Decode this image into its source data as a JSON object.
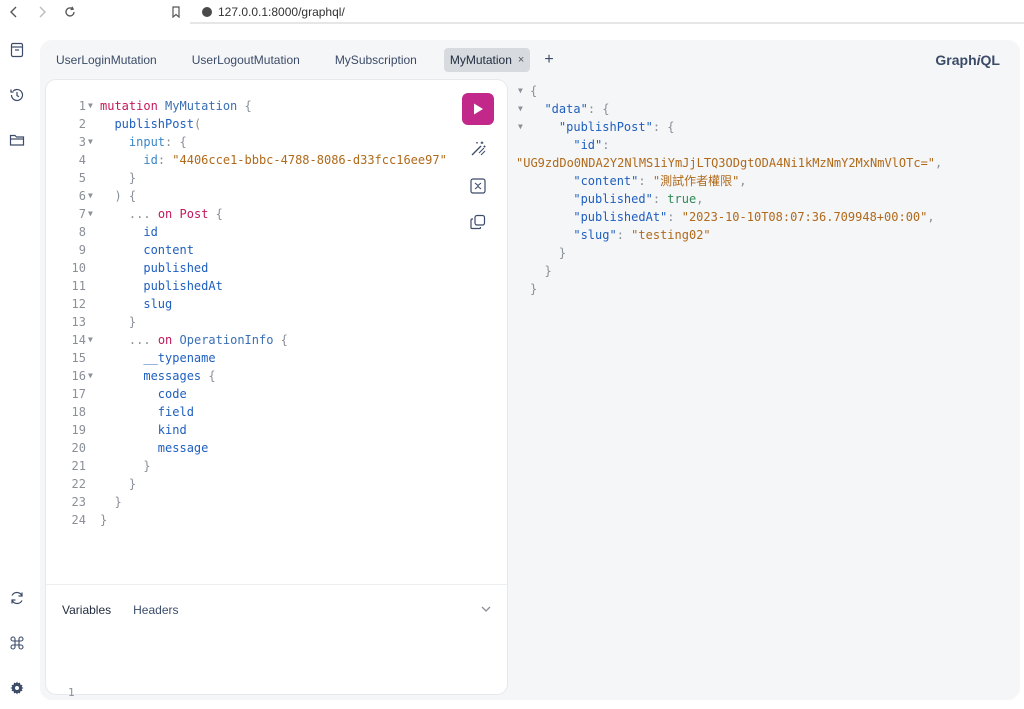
{
  "browser": {
    "url": "127.0.0.1:8000/graphql/"
  },
  "tabs": [
    {
      "label": "UserLoginMutation",
      "active": false
    },
    {
      "label": "UserLogoutMutation",
      "active": false
    },
    {
      "label": "MySubscription",
      "active": false
    },
    {
      "label": "MyMutation",
      "active": true
    }
  ],
  "tab_close": "×",
  "tab_add": "+",
  "brand": {
    "prefix": "Graph",
    "italic": "i",
    "suffix": "QL"
  },
  "editor": {
    "lines": [
      {
        "n": "1",
        "fold": true
      },
      {
        "n": "2",
        "fold": false
      },
      {
        "n": "3",
        "fold": true
      },
      {
        "n": "4",
        "fold": false
      },
      {
        "n": "5",
        "fold": false
      },
      {
        "n": "6",
        "fold": true
      },
      {
        "n": "7",
        "fold": true
      },
      {
        "n": "8",
        "fold": false
      },
      {
        "n": "9",
        "fold": false
      },
      {
        "n": "10",
        "fold": false
      },
      {
        "n": "11",
        "fold": false
      },
      {
        "n": "12",
        "fold": false
      },
      {
        "n": "13",
        "fold": false
      },
      {
        "n": "14",
        "fold": true
      },
      {
        "n": "15",
        "fold": false
      },
      {
        "n": "16",
        "fold": true
      },
      {
        "n": "17",
        "fold": false
      },
      {
        "n": "18",
        "fold": false
      },
      {
        "n": "19",
        "fold": false
      },
      {
        "n": "20",
        "fold": false
      },
      {
        "n": "21",
        "fold": false
      },
      {
        "n": "22",
        "fold": false
      },
      {
        "n": "23",
        "fold": false
      },
      {
        "n": "24",
        "fold": false
      }
    ],
    "tokens": {
      "mutation_kw": "mutation",
      "op_name": "MyMutation",
      "publish_post": "publishPost",
      "input": "input",
      "id_arg": "id",
      "id_value": "\"4406cce1-bbbc-4788-8086-d33fcc16ee97\"",
      "spread": "...",
      "on": "on",
      "post_type": "Post",
      "field_id": "id",
      "field_content": "content",
      "field_published": "published",
      "field_published_at": "publishedAt",
      "field_slug": "slug",
      "opinfo_type": "OperationInfo",
      "typename": "__typename",
      "messages": "messages",
      "code": "code",
      "field": "field",
      "kind": "kind",
      "message": "message"
    }
  },
  "variables_panel": {
    "tabs": [
      "Variables",
      "Headers"
    ],
    "line_number": "1"
  },
  "result": {
    "data_key": "\"data\"",
    "publish_post_key": "\"publishPost\"",
    "id_key": "\"id\"",
    "id_value": "\"UG9zdDo0NDA2Y2NlMS1iYmJjLTQ3ODgtODA4Ni1kMzNmY2MxNmVlOTc=\"",
    "content_key": "\"content\"",
    "content_value": "\"測試作者權限\"",
    "published_key": "\"published\"",
    "published_value": "true",
    "published_at_key": "\"publishedAt\"",
    "published_at_value": "\"2023-10-10T08:07:36.709948+00:00\"",
    "slug_key": "\"slug\"",
    "slug_value": "\"testing02\""
  },
  "icons": {
    "run": "play-icon",
    "prettify": "magic-wand-icon",
    "merge": "merge-fragments-icon",
    "copy": "copy-icon"
  },
  "colors": {
    "run_button": "#c2288a",
    "keyword": "#c2185b",
    "string": "#b06a1b",
    "field": "#1f5fbf",
    "boolean": "#2e8b57"
  }
}
